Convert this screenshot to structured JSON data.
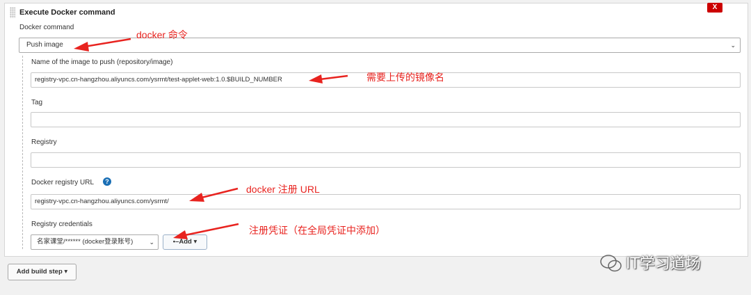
{
  "step": {
    "title": "Execute Docker command",
    "delete_label": "X"
  },
  "fields": {
    "docker_command_label": "Docker command",
    "docker_command_value": "Push image",
    "image_name_label": "Name of the image to push (repository/image)",
    "image_name_value": "registry-vpc.cn-hangzhou.aliyuncs.com/ysrmt/test-applet-web:1.0.$BUILD_NUMBER",
    "tag_label": "Tag",
    "tag_value": "",
    "registry_label": "Registry",
    "registry_value": "",
    "registry_url_label": "Docker registry URL",
    "registry_url_value": "registry-vpc.cn-hangzhou.aliyuncs.com/ysrmt/",
    "credentials_label": "Registry credentials",
    "credentials_value": "名家课堂/****** (docker登录账号)",
    "add_label": "Add",
    "help_icon": "question-mark-icon"
  },
  "actions": {
    "add_build_step_label": "Add build step"
  },
  "annotations": {
    "docker_command": "docker 命令",
    "image_name": "需要上传的镜像名",
    "registry_url": "docker 注册 URL",
    "credentials": "注册凭证（在全局凭证中添加）"
  },
  "watermark": {
    "text": "IT学习道场"
  },
  "colors": {
    "annotation": "#e8231f",
    "delete_button": "#cc0000",
    "help_icon": "#1a6fb5"
  }
}
